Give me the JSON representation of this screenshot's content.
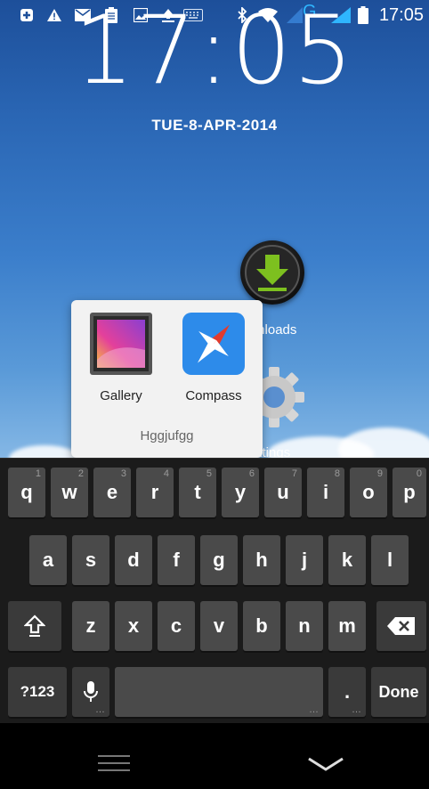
{
  "status_bar": {
    "time": "17:05",
    "left_icons": [
      "medical-plus-icon",
      "warning-icon",
      "mail-icon",
      "clipboard-icon",
      "image-icon",
      "upload-icon",
      "keyboard-icon"
    ],
    "right_icons": [
      "bluetooth-icon",
      "wifi-icon",
      "signal-g-icon",
      "signal-bars-icon",
      "battery-icon"
    ],
    "network_label": "G"
  },
  "lockscreen": {
    "clock": "17:05",
    "date": "TUE-8-APR-2014"
  },
  "home": {
    "downloads_label": "ownloads",
    "settings_label": "Settings"
  },
  "folder": {
    "name": "Hggjufgg",
    "apps": [
      {
        "label": "Gallery"
      },
      {
        "label": "Compass"
      }
    ]
  },
  "keyboard": {
    "row1": [
      {
        "k": "q",
        "h": "1"
      },
      {
        "k": "w",
        "h": "2"
      },
      {
        "k": "e",
        "h": "3"
      },
      {
        "k": "r",
        "h": "4"
      },
      {
        "k": "t",
        "h": "5"
      },
      {
        "k": "y",
        "h": "6"
      },
      {
        "k": "u",
        "h": "7"
      },
      {
        "k": "i",
        "h": "8"
      },
      {
        "k": "o",
        "h": "9"
      },
      {
        "k": "p",
        "h": "0"
      }
    ],
    "row2": [
      "a",
      "s",
      "d",
      "f",
      "g",
      "h",
      "j",
      "k",
      "l"
    ],
    "row3": [
      "z",
      "x",
      "c",
      "v",
      "b",
      "n",
      "m"
    ],
    "symbols_key": "?123",
    "period_key": ".",
    "done_key": "Done"
  },
  "colors": {
    "key_bg": "#4a4a4a",
    "keyboard_bg": "#1b1b1b",
    "downloads_green": "#7dc01f",
    "compass_blue": "#2d8bea"
  }
}
